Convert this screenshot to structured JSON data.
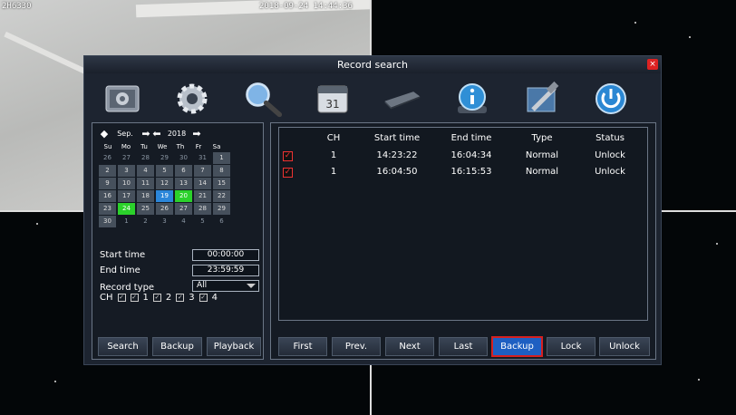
{
  "overlay": {
    "cam_name": "2H6330",
    "timestamp": "2018-09-24 14:44:36"
  },
  "dialog": {
    "title": "Record search",
    "close_label": "×"
  },
  "toolbar": [
    {
      "name": "system-settings-icon"
    },
    {
      "name": "gear-icon"
    },
    {
      "name": "search-icon"
    },
    {
      "name": "calendar-icon"
    },
    {
      "name": "hdd-icon"
    },
    {
      "name": "info-icon"
    },
    {
      "name": "tools-icon"
    },
    {
      "name": "power-icon"
    }
  ],
  "calendar": {
    "month": "Sep.",
    "year": "2018",
    "dows": [
      "Su",
      "Mo",
      "Tu",
      "We",
      "Th",
      "Fr",
      "Sa"
    ],
    "days": [
      [
        "26",
        "other"
      ],
      [
        "27",
        "other"
      ],
      [
        "28",
        "other"
      ],
      [
        "29",
        "other"
      ],
      [
        "30",
        "other"
      ],
      [
        "31",
        "other"
      ],
      [
        "1",
        "normal"
      ],
      [
        "2",
        "normal"
      ],
      [
        "3",
        "normal"
      ],
      [
        "4",
        "normal"
      ],
      [
        "5",
        "normal"
      ],
      [
        "6",
        "normal"
      ],
      [
        "7",
        "normal"
      ],
      [
        "8",
        "normal"
      ],
      [
        "9",
        "normal"
      ],
      [
        "10",
        "normal"
      ],
      [
        "11",
        "normal"
      ],
      [
        "12",
        "normal"
      ],
      [
        "13",
        "normal"
      ],
      [
        "14",
        "normal"
      ],
      [
        "15",
        "normal"
      ],
      [
        "16",
        "normal"
      ],
      [
        "17",
        "normal"
      ],
      [
        "18",
        "normal"
      ],
      [
        "19",
        "sel"
      ],
      [
        "20",
        "rec"
      ],
      [
        "21",
        "normal"
      ],
      [
        "22",
        "normal"
      ],
      [
        "23",
        "normal"
      ],
      [
        "24",
        "rec"
      ],
      [
        "25",
        "normal"
      ],
      [
        "26",
        "normal"
      ],
      [
        "27",
        "normal"
      ],
      [
        "28",
        "normal"
      ],
      [
        "29",
        "normal"
      ],
      [
        "30",
        "normal"
      ],
      [
        "1",
        "other"
      ],
      [
        "2",
        "other"
      ],
      [
        "3",
        "other"
      ],
      [
        "4",
        "other"
      ],
      [
        "5",
        "other"
      ],
      [
        "6",
        "other"
      ]
    ]
  },
  "search": {
    "start_label": "Start time",
    "start_value": "00:00:00",
    "end_label": "End time",
    "end_value": "23:59:59",
    "type_label": "Record type",
    "type_value": "All",
    "ch_label": "CH",
    "channels": [
      "1",
      "2",
      "3",
      "4"
    ]
  },
  "left_buttons": {
    "search": "Search",
    "backup": "Backup",
    "playback": "Playback"
  },
  "table": {
    "headers": {
      "ch": "CH",
      "start": "Start time",
      "end": "End time",
      "type": "Type",
      "status": "Status"
    },
    "rows": [
      {
        "ch": "1",
        "start": "14:23:22",
        "end": "16:04:34",
        "type": "Normal",
        "status": "Unlock"
      },
      {
        "ch": "1",
        "start": "16:04:50",
        "end": "16:15:53",
        "type": "Normal",
        "status": "Unlock"
      }
    ]
  },
  "bottom_buttons": {
    "first": "First",
    "prev": "Prev.",
    "next": "Next",
    "last": "Last",
    "backup": "Backup",
    "lock": "Lock",
    "unlock": "Unlock"
  },
  "colors": {
    "record_day": "#2bd12b",
    "selected_day": "#2b86d9",
    "highlight_border": "#d62020",
    "close": "#dd2222"
  }
}
